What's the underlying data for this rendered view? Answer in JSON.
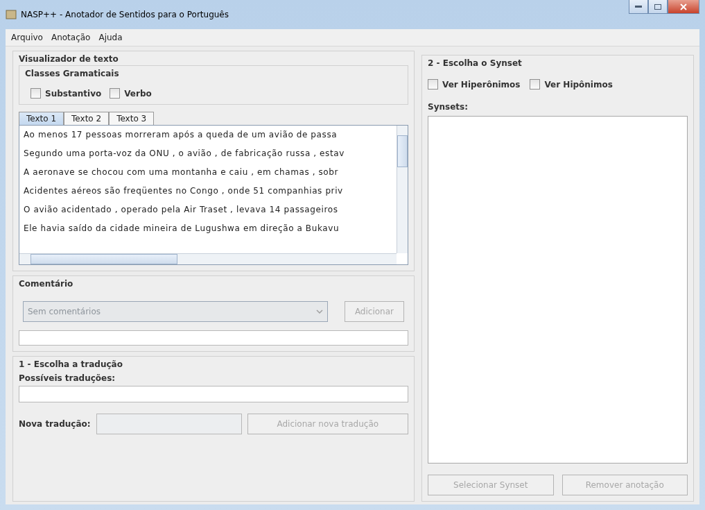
{
  "window": {
    "title": "NASP++ - Anotador de Sentidos para o Português"
  },
  "menu": [
    "Arquivo",
    "Anotação",
    "Ajuda"
  ],
  "text_viewer": {
    "title": "Visualizador de texto",
    "classes": {
      "title": "Classes Gramaticais",
      "options": [
        {
          "label": "Substantivo",
          "checked": false
        },
        {
          "label": "Verbo",
          "checked": false
        }
      ]
    },
    "tabs": [
      {
        "label": "Texto 1",
        "selected": true
      },
      {
        "label": "Texto 2",
        "selected": false
      },
      {
        "label": "Texto 3",
        "selected": false
      }
    ],
    "lines": [
      "Ao menos 17 pessoas morreram após a queda de um avião de passa",
      "Segundo uma porta-voz da ONU , o avião , de fabricação russa , estav",
      "A aeronave se chocou com uma montanha e caiu , em chamas , sobr",
      "Acidentes aéreos são freqüentes no Congo , onde 51 companhias priv",
      "O avião acidentado , operado pela Air Traset , levava 14 passageiros",
      "Ele havia saído da cidade mineira de Lugushwa em direção a Bukavu"
    ]
  },
  "comment": {
    "title": "Comentário",
    "combo": {
      "value": "Sem comentários",
      "disabled": true
    },
    "add_button": {
      "label": "Adicionar",
      "disabled": true
    }
  },
  "translation": {
    "title": "1 - Escolha a tradução",
    "possible_label": "Possíveis traduções:",
    "new_label": "Nova tradução:",
    "add_button": {
      "label": "Adicionar nova tradução",
      "disabled": true
    }
  },
  "synset": {
    "title": "2 - Escolha o Synset",
    "options": [
      {
        "label": "Ver Hiperônimos",
        "checked": false
      },
      {
        "label": "Ver Hipônimos",
        "checked": false
      }
    ],
    "list_label": "Synsets:",
    "buttons": [
      {
        "label": "Selecionar Synset",
        "disabled": true
      },
      {
        "label": "Remover anotação",
        "disabled": true
      }
    ]
  }
}
